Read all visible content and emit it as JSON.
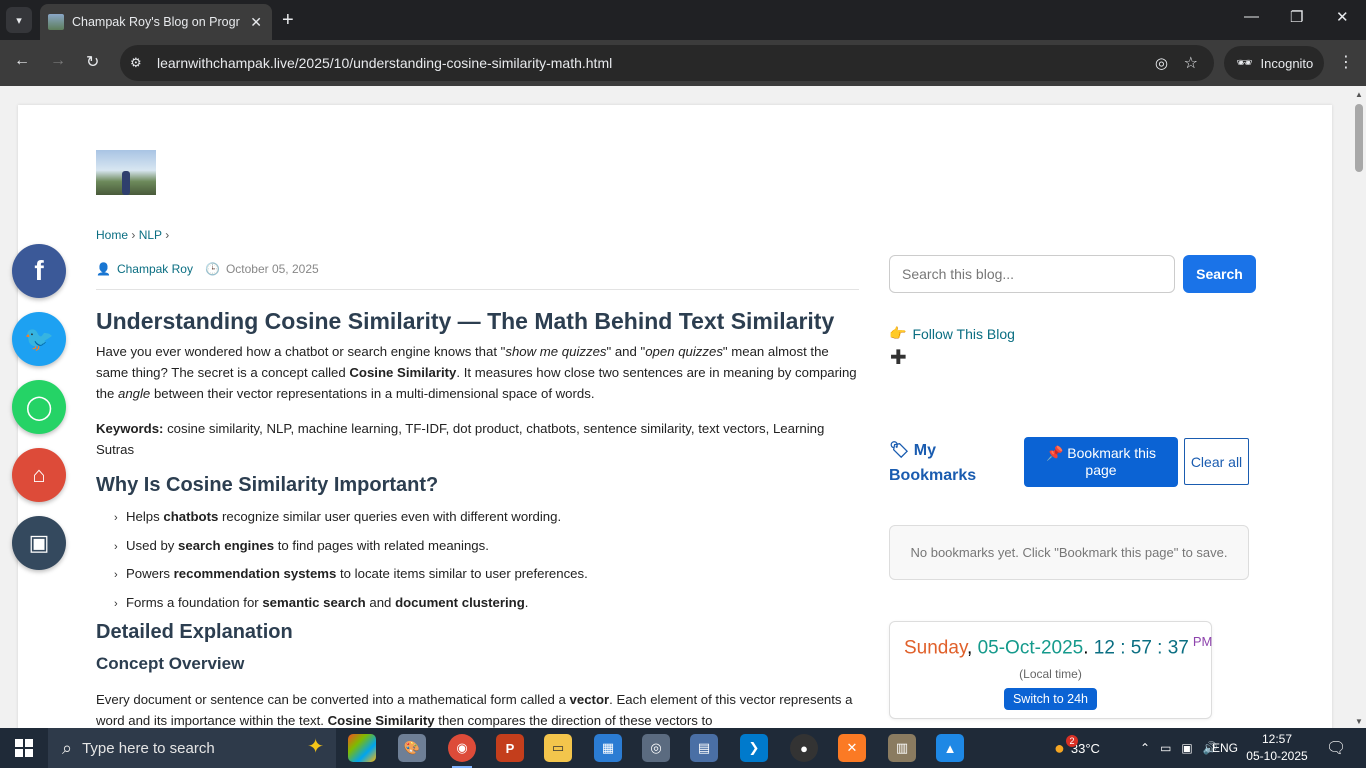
{
  "browser": {
    "tab_title": "Champak Roy's Blog on Programming",
    "url": "learnwithchampak.live/2025/10/understanding-cosine-similarity-math.html",
    "incognito_label": "Incognito"
  },
  "blog": {
    "breadcrumb": {
      "home": "Home",
      "sep1": "›",
      "nlp": "NLP",
      "sep2": "›"
    },
    "author": "Champak Roy",
    "date": "October 05, 2025",
    "title": "Understanding Cosine Similarity — The Math Behind Text Similarity",
    "intro": {
      "t1": "Have you ever wondered how a chatbot or search engine knows that \"",
      "q1": "show me quizzes",
      "t2": "\" and \"",
      "q2": "open quizzes",
      "t3": "\" mean almost the same thing? The secret is a concept called ",
      "b1": "Cosine Similarity",
      "t4": ". It measures how close two sentences are in meaning by comparing the ",
      "i1": "angle",
      "t5": " between their vector representations in a multi-dimensional space of words."
    },
    "keywords_label": "Keywords:",
    "keywords": " cosine similarity, NLP, machine learning, TF-IDF, dot product, chatbots, sentence similarity, text vectors, Learning Sutras",
    "h2_why": "Why Is Cosine Similarity Important?",
    "bullets": [
      {
        "pre": "Helps ",
        "bold": "chatbots",
        "post": " recognize similar user queries even with different wording."
      },
      {
        "pre": "Used by ",
        "bold": "search engines",
        "post": " to find pages with related meanings."
      },
      {
        "pre": "Powers ",
        "bold": "recommendation systems",
        "post": " to locate items similar to user preferences."
      },
      {
        "pre": "Forms a foundation for ",
        "bold": "semantic search",
        "mid": " and ",
        "bold2": "document clustering",
        "post": "."
      }
    ],
    "h2_detail": "Detailed Explanation",
    "h3_concept": "Concept Overview",
    "concept": {
      "t1": "Every document or sentence can be converted into a mathematical form called a ",
      "b1": "vector",
      "t2": ". Each element of this vector represents a word and its importance within the text. ",
      "b2": "Cosine Similarity",
      "t3": " then compares the direction of these vectors to"
    }
  },
  "sidebar": {
    "search_placeholder": "Search this blog...",
    "search_button": "Search",
    "follow_label": "Follow This Blog",
    "bookmarks_title": "My Bookmarks",
    "bookmark_button": "📌 Bookmark this page",
    "clear_button": "Clear all",
    "bookmarks_empty": "No bookmarks yet. Click \"Bookmark this page\" to save.",
    "clock": {
      "day": "Sunday",
      "comma": ", ",
      "date": "05-Oct-2025",
      "dot": ". ",
      "time": "12 : 57 : 37",
      "ampm": "PM",
      "sub": "(Local time)",
      "switch_button": "Switch to 24h"
    }
  },
  "taskbar": {
    "search_placeholder": "Type here to search",
    "weather": "33°C",
    "language": "ENG",
    "time": "12:57",
    "date": "05-10-2025",
    "weather_badge": "2"
  }
}
